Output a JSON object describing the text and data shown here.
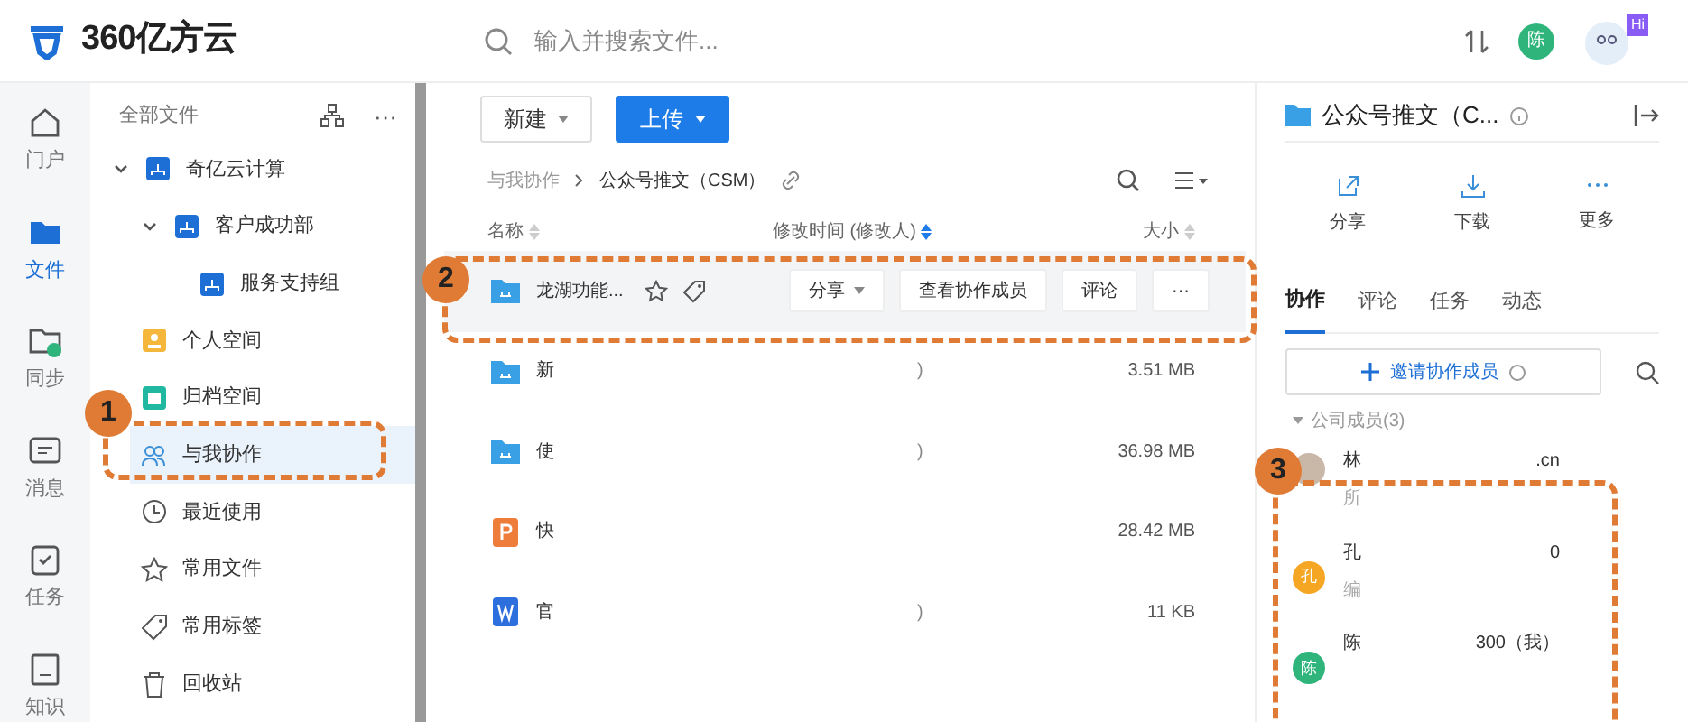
{
  "header": {
    "logo_text": "360亿方云",
    "search": {
      "placeholder": "输入并搜索文件..."
    },
    "user_avatar": "陈",
    "badge": "Hi"
  },
  "rail": [
    {
      "kind": "home",
      "label": "门户",
      "selected": false
    },
    {
      "kind": "folder",
      "label": "文件",
      "selected": true
    },
    {
      "kind": "sync",
      "label": "同步",
      "selected": false
    },
    {
      "kind": "message",
      "label": "消息",
      "selected": false
    },
    {
      "kind": "task",
      "label": "任务",
      "selected": false
    },
    {
      "kind": "knowledge",
      "label": "知识",
      "selected": false
    }
  ],
  "tree": {
    "title": "全部文件",
    "more": "···",
    "items": [
      {
        "kind": "org",
        "label": "奇亿云计算",
        "selected": false,
        "expanded": true,
        "children": [
          {
            "kind": "org",
            "label": "客户成功部",
            "selected": false,
            "expanded": true,
            "children": [
              {
                "kind": "org",
                "label": "服务支持组",
                "selected": false
              }
            ]
          }
        ]
      },
      {
        "kind": "personal",
        "label": "个人空间",
        "selected": false
      },
      {
        "kind": "archive",
        "label": "归档空间",
        "selected": false
      },
      {
        "kind": "shared",
        "label": "与我协作",
        "selected": true
      },
      {
        "kind": "recent",
        "label": "最近使用",
        "selected": false
      },
      {
        "kind": "star",
        "label": "常用文件",
        "selected": false
      },
      {
        "kind": "tag",
        "label": "常用标签",
        "selected": false
      },
      {
        "kind": "trash",
        "label": "回收站",
        "selected": false
      }
    ]
  },
  "toolbar": {
    "buttons": [
      {
        "kind": "plain",
        "label": "新建"
      },
      {
        "kind": "primary",
        "label": "上传"
      }
    ]
  },
  "breadcrumb": [
    "与我协作",
    "公众号推文（CSM）"
  ],
  "table": {
    "columns": [
      "名称",
      "修改时间 (修改人)",
      "大小"
    ],
    "rows": [
      {
        "kind": "folder",
        "name": "龙湖功能...",
        "modified": "",
        "size": "",
        "hovered": true,
        "actions": [
          "分享",
          "查看协作成员",
          "评论",
          "···"
        ]
      },
      {
        "kind": "folder",
        "name": "新",
        "modified": ")",
        "size": "3.51 MB",
        "hovered": false
      },
      {
        "kind": "folder",
        "name": "使",
        "modified": ")",
        "size": "36.98 MB",
        "hovered": false
      },
      {
        "kind": "ppt",
        "name": "快",
        "modified": "",
        "size": "28.42 MB",
        "hovered": false
      },
      {
        "kind": "word",
        "name": "官",
        "modified": ")",
        "size": "11 KB",
        "hovered": false
      }
    ]
  },
  "panel": {
    "title": "公众号推文（C...",
    "actions": [
      {
        "kind": "share",
        "label": "分享"
      },
      {
        "kind": "download",
        "label": "下载"
      },
      {
        "kind": "more",
        "label": "更多"
      }
    ],
    "tabs": [
      {
        "label": "协作",
        "selected": true
      },
      {
        "label": "评论",
        "selected": false
      },
      {
        "label": "任务",
        "selected": false
      },
      {
        "label": "动态",
        "selected": false
      }
    ],
    "invite_button": "邀请协作成员",
    "group": {
      "label": "公司成员(3)",
      "expanded": true
    },
    "members": [
      {
        "kind": "photo",
        "name": "林",
        "contact": ".cn",
        "role": "所"
      },
      {
        "kind": "letter",
        "avatar_text": "孔",
        "color": "#f5a623",
        "name": "孔",
        "contact": "0",
        "role": "编"
      },
      {
        "kind": "letter",
        "avatar_text": "陈",
        "color": "#2fb57c",
        "name": "陈",
        "contact": "300（我）"
      }
    ]
  },
  "callouts": [
    "1",
    "2",
    "3"
  ]
}
